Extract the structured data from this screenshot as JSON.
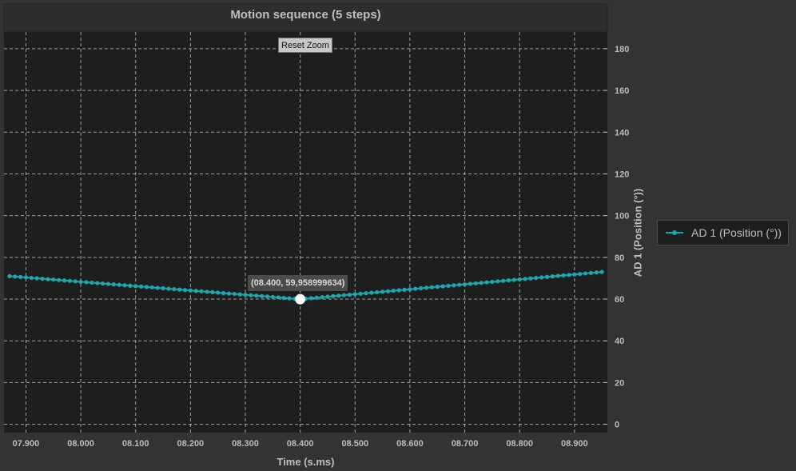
{
  "reset_zoom_label": "Reset Zoom",
  "tooltip_text": "(08.400, 59,958999634)",
  "legend": {
    "label": "AD 1 (Position (°))",
    "color": "#1ba8b0"
  },
  "colors": {
    "background": "#333333",
    "plot_bg": "#1e1e1e",
    "title_bar": "#2e2e2e",
    "grid": "#cfcfcf",
    "series": "#1ba8b0",
    "highlight": "#ffffff"
  },
  "chart_data": {
    "type": "line",
    "title": "Motion sequence (5 steps)",
    "xlabel": "Time (s.ms)",
    "ylabel": "AD 1 (Position (°))",
    "xlim": [
      7.86,
      8.96
    ],
    "ylim": [
      -4,
      188
    ],
    "x_tick_values": [
      7.9,
      8.0,
      8.1,
      8.2,
      8.3,
      8.4,
      8.5,
      8.6,
      8.7,
      8.8,
      8.9
    ],
    "x_tick_labels": [
      "07.900",
      "08.000",
      "08.100",
      "08.200",
      "08.300",
      "08.400",
      "08.500",
      "08.600",
      "08.700",
      "08.800",
      "08.900"
    ],
    "y_ticks": [
      0,
      20,
      40,
      60,
      80,
      100,
      120,
      140,
      160,
      180
    ],
    "y_axis_position": "right",
    "grid": true,
    "legend_position": "right",
    "series": [
      {
        "name": "AD 1 (Position (°))",
        "x_start": 7.87,
        "x_step": 0.01,
        "count": 109,
        "values_at_keypoints": {
          "7.870": 71.0,
          "8.400": 59.959,
          "8.950": 73.0
        }
      }
    ],
    "highlight_point": {
      "x": 8.4,
      "y": 59.958999634
    }
  }
}
